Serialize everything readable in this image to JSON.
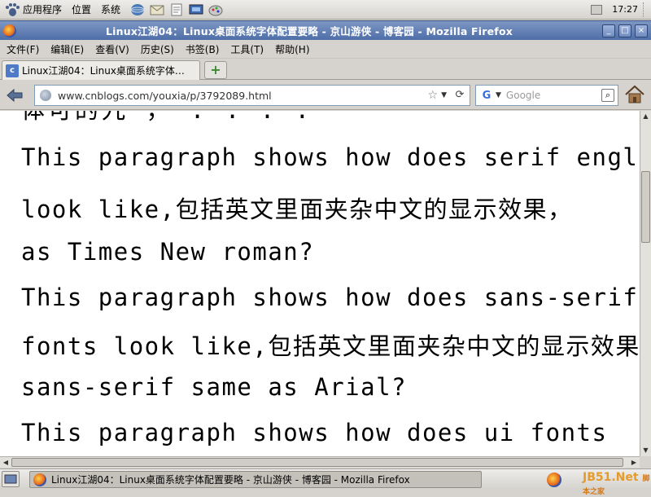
{
  "top_panel": {
    "menus": [
      "应用程序",
      "位置",
      "系统"
    ],
    "clock": "17:27"
  },
  "window": {
    "title": "Linux江湖04：Linux桌面系统字体配置要略 - 京山游侠 - 博客园 - Mozilla Firefox",
    "controls": [
      "_",
      "□",
      "×"
    ]
  },
  "menubar": [
    "文件(F)",
    "编辑(E)",
    "查看(V)",
    "历史(S)",
    "书签(B)",
    "工具(T)",
    "帮助(H)"
  ],
  "tabs": [
    {
      "label": "Linux江湖04：Linux桌面系统字体…"
    }
  ],
  "new_tab_label": "+",
  "navbar": {
    "url": "www.cnblogs.com/youxia/p/3792089.html",
    "search_placeholder": "Google"
  },
  "content": {
    "cut_line": "体可的九 ，    .   .   .   .",
    "lines": [
      "  This paragraph shows how does serif english",
      "look like,包括英文里面夹杂中文的显示效果，",
      "as Times New roman?",
      "  This paragraph shows how does sans-serif",
      "fonts look like,包括英文里面夹杂中文的显示效果",
      "sans-serif same as Arial?",
      "  This paragraph shows how does ui fonts"
    ]
  },
  "taskbar": {
    "task_label": "Linux江湖04：Linux桌面系统字体配置要略 - 京山游侠 - 博客园 - Mozilla Firefox",
    "watermark": "JB51.Net",
    "watermark_sub": "脚本之家"
  }
}
